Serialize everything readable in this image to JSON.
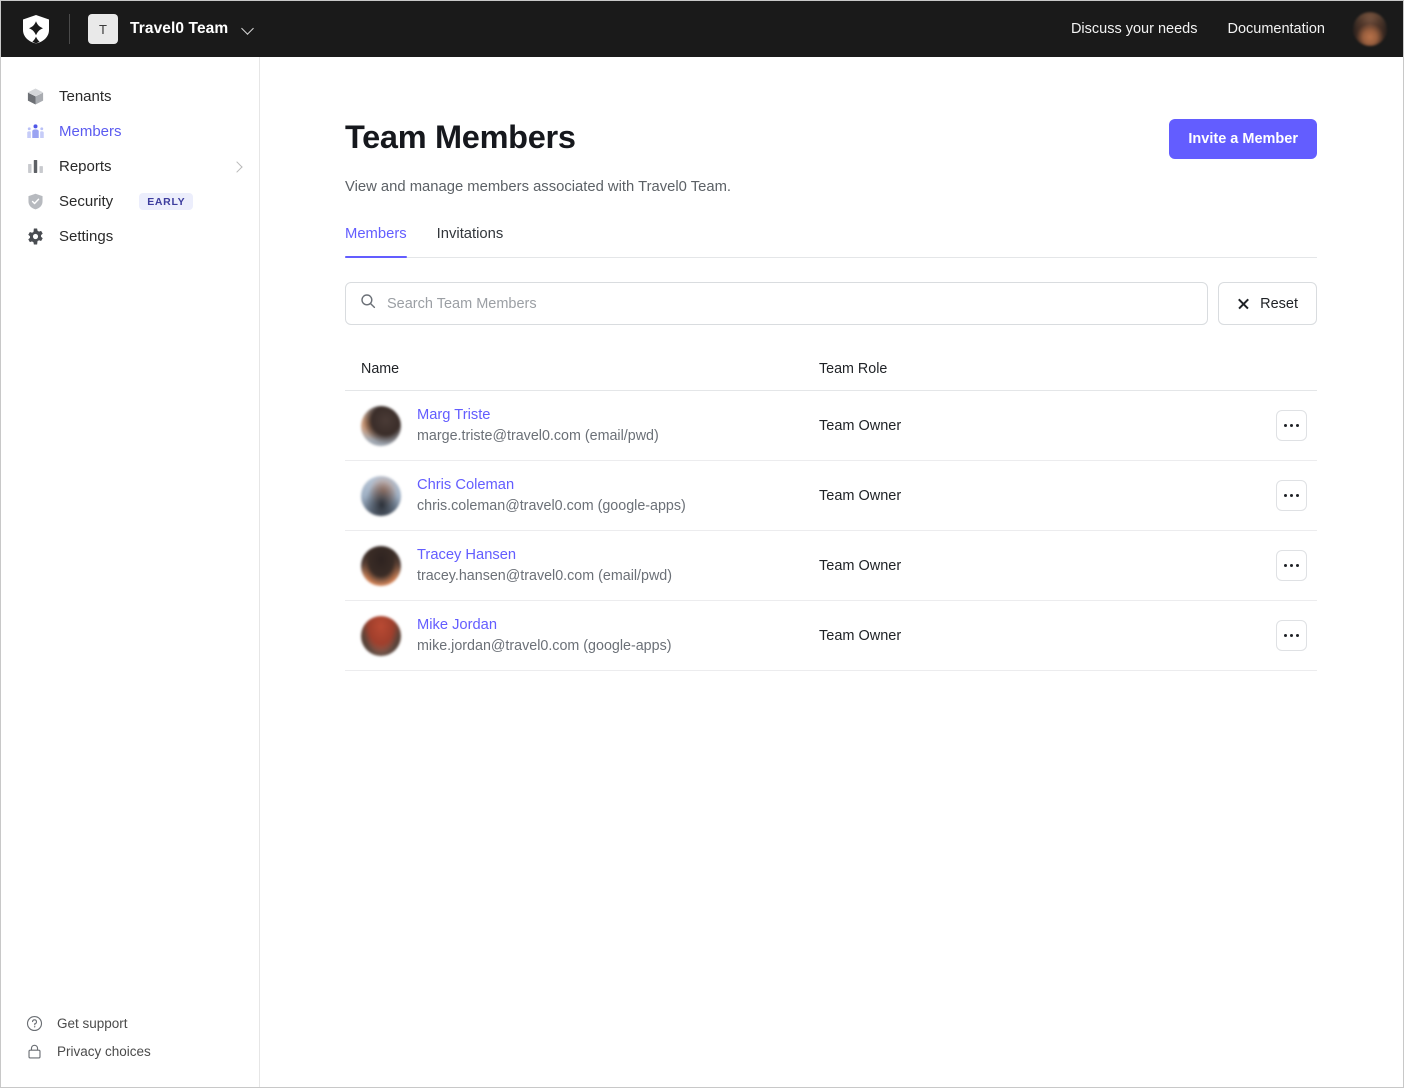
{
  "topbar": {
    "logo_icon": "shield-logo-icon",
    "team_initial": "T",
    "team_name": "Travel0 Team",
    "team_switch_icon": "chevron-down-icon",
    "links": [
      {
        "label": "Discuss your needs",
        "name": "discuss-your-needs-link"
      },
      {
        "label": "Documentation",
        "name": "documentation-link"
      }
    ],
    "avatar_icon": "user-avatar"
  },
  "sidebar": {
    "items": [
      {
        "label": "Tenants",
        "icon": "cube-icon",
        "active": false,
        "badge": null,
        "chevron": false
      },
      {
        "label": "Members",
        "icon": "people-icon",
        "active": true,
        "badge": null,
        "chevron": false
      },
      {
        "label": "Reports",
        "icon": "bar-chart-icon",
        "active": false,
        "badge": null,
        "chevron": true
      },
      {
        "label": "Security",
        "icon": "shield-check-icon",
        "active": false,
        "badge": "EARLY",
        "chevron": false
      },
      {
        "label": "Settings",
        "icon": "gear-icon",
        "active": false,
        "badge": null,
        "chevron": false
      }
    ],
    "footer": [
      {
        "label": "Get support",
        "icon": "question-circle-icon"
      },
      {
        "label": "Privacy choices",
        "icon": "lock-icon"
      }
    ]
  },
  "main": {
    "title": "Team Members",
    "invite_button": "Invite a Member",
    "subtitle": "View and manage members associated with Travel0 Team.",
    "tabs": [
      {
        "label": "Members",
        "active": true
      },
      {
        "label": "Invitations",
        "active": false
      }
    ],
    "search": {
      "placeholder": "Search Team Members",
      "value": "",
      "icon": "search-icon",
      "reset_label": "Reset",
      "reset_icon": "close-x-icon"
    },
    "table": {
      "columns": [
        "Name",
        "Team Role"
      ],
      "rows": [
        {
          "name": "Marg Triste",
          "email": "marge.triste@travel0.com (email/pwd)",
          "role": "Team Owner",
          "avatar": "av1"
        },
        {
          "name": "Chris Coleman",
          "email": "chris.coleman@travel0.com (google-apps)",
          "role": "Team Owner",
          "avatar": "av2"
        },
        {
          "name": "Tracey Hansen",
          "email": "tracey.hansen@travel0.com (email/pwd)",
          "role": "Team Owner",
          "avatar": "av3"
        },
        {
          "name": "Mike Jordan",
          "email": "mike.jordan@travel0.com (google-apps)",
          "role": "Team Owner",
          "avatar": "av4"
        }
      ],
      "row_action_icon": "kebab-menu-icon"
    }
  },
  "colors": {
    "accent": "#635dff",
    "topbar_bg": "#1a1a1a",
    "badge_bg": "#eceefc",
    "badge_text": "#3d3d9e"
  }
}
